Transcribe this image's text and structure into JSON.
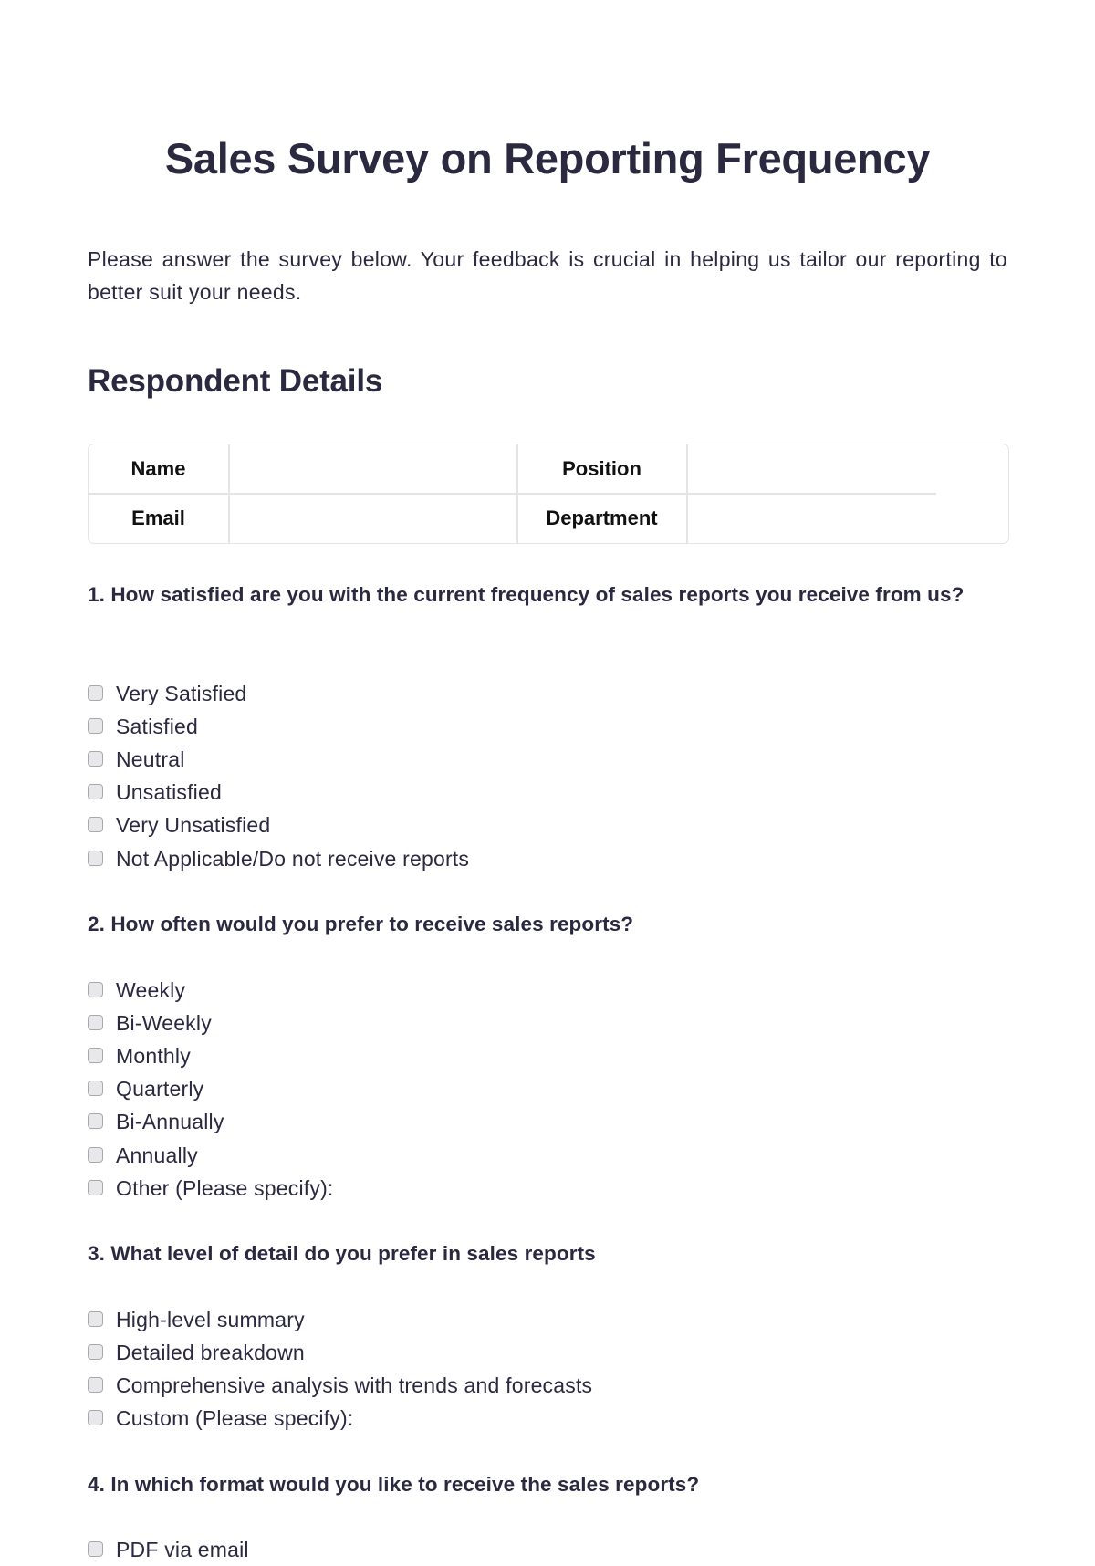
{
  "document": {
    "title": "Sales Survey on Reporting Frequency",
    "intro": "Please answer the survey below. Your feedback is crucial in helping us tailor our reporting to better suit your needs."
  },
  "respondent_details": {
    "heading": "Respondent Details",
    "fields": [
      {
        "label": "Name",
        "value": ""
      },
      {
        "label": "Position",
        "value": ""
      },
      {
        "label": "Email",
        "value": ""
      },
      {
        "label": "Department",
        "value": ""
      }
    ]
  },
  "questions": [
    {
      "text": "1. How satisfied are you with the current frequency of sales reports you receive from us?",
      "options": [
        "Very Satisfied",
        "Satisfied",
        "Neutral",
        "Unsatisfied",
        "Very Unsatisfied",
        "Not Applicable/Do not receive reports"
      ]
    },
    {
      "text": "2. How often would you prefer to receive sales reports?",
      "options": [
        "Weekly",
        "Bi-Weekly",
        "Monthly",
        "Quarterly",
        "Bi-Annually",
        "Annually",
        "Other (Please specify):"
      ]
    },
    {
      "text": "3. What level of detail do you prefer in sales reports",
      "options": [
        "High-level summary",
        "Detailed breakdown",
        "Comprehensive analysis with trends and forecasts",
        "Custom (Please specify):"
      ]
    },
    {
      "text": "4. In which format would you like to receive the sales reports?",
      "options": [
        "PDF via email"
      ]
    }
  ],
  "colors": {
    "text": "#2a2940",
    "table_border": "#e4e4e7",
    "checkbox_border": "#a9a9ad",
    "checkbox_fill": "#e8e8ea"
  }
}
